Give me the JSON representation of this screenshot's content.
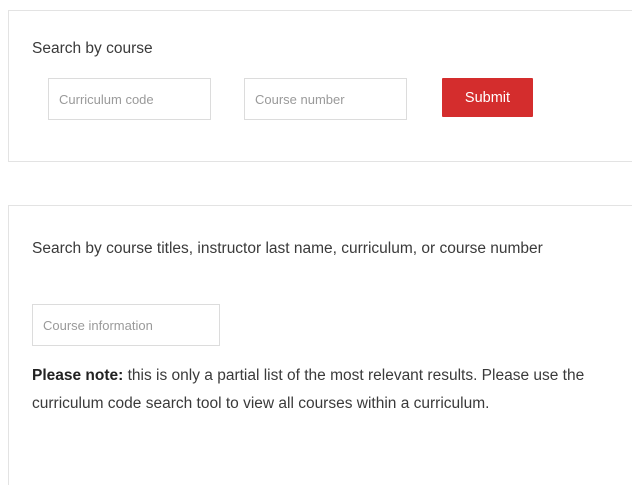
{
  "course_search": {
    "heading": "Search by course",
    "curriculum_code": {
      "placeholder": "Curriculum code",
      "value": ""
    },
    "course_number": {
      "placeholder": "Course number",
      "value": ""
    },
    "submit_label": "Submit"
  },
  "info_search": {
    "heading": "Search by course titles, instructor last name, curriculum, or course number",
    "course_information": {
      "placeholder": "Course information",
      "value": ""
    },
    "note_label": "Please note:",
    "note_text": " this is only a partial list of the most relevant results. Please use the curriculum code search tool to view all courses within a curriculum."
  },
  "colors": {
    "accent": "#d42d2d",
    "border": "#e3e3e3",
    "text": "#3a3a3a"
  }
}
